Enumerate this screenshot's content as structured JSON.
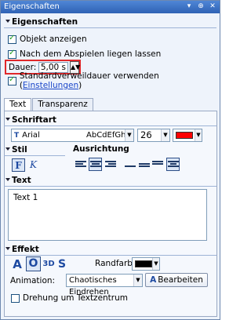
{
  "window": {
    "title": "Eigenschaften",
    "controls": [
      "▾",
      "⊕",
      "✕"
    ]
  },
  "properties": {
    "section_title": "Eigenschaften",
    "show_object_label": "Objekt anzeigen",
    "hide_after_label": "Nach dem Abspielen liegen lassen",
    "duration_label": "Dauer:",
    "duration_value": "5,00 s",
    "default_duration_label": "Standardverweildauer verwenden (",
    "settings_link": "Einstellungen",
    "default_duration_suffix": ")"
  },
  "tabs": [
    "Text",
    "Transparenz"
  ],
  "font": {
    "section_title": "Schriftart",
    "family": "Arial",
    "preview": "AbCdEfGhIj",
    "size": "26",
    "color": "#ff0000"
  },
  "style": {
    "section_title": "Stil",
    "alignment_title": "Ausrichtung",
    "bold_glyph": "F",
    "italic_glyph": "K"
  },
  "text": {
    "section_title": "Text",
    "content": "Text 1"
  },
  "effect": {
    "section_title": "Effekt",
    "glyph_plain": "A",
    "glyph_outline": "O",
    "glyph_3d": "3D",
    "glyph_shadow": "S",
    "border_color_label": "Randfarbe:",
    "border_color": "#000000",
    "animation_label": "Animation:",
    "animation_value": "Chaotisches Eindrehen",
    "edit_button": "Bearbeiten",
    "rotate_label": "Drehung um Textzentrum"
  }
}
